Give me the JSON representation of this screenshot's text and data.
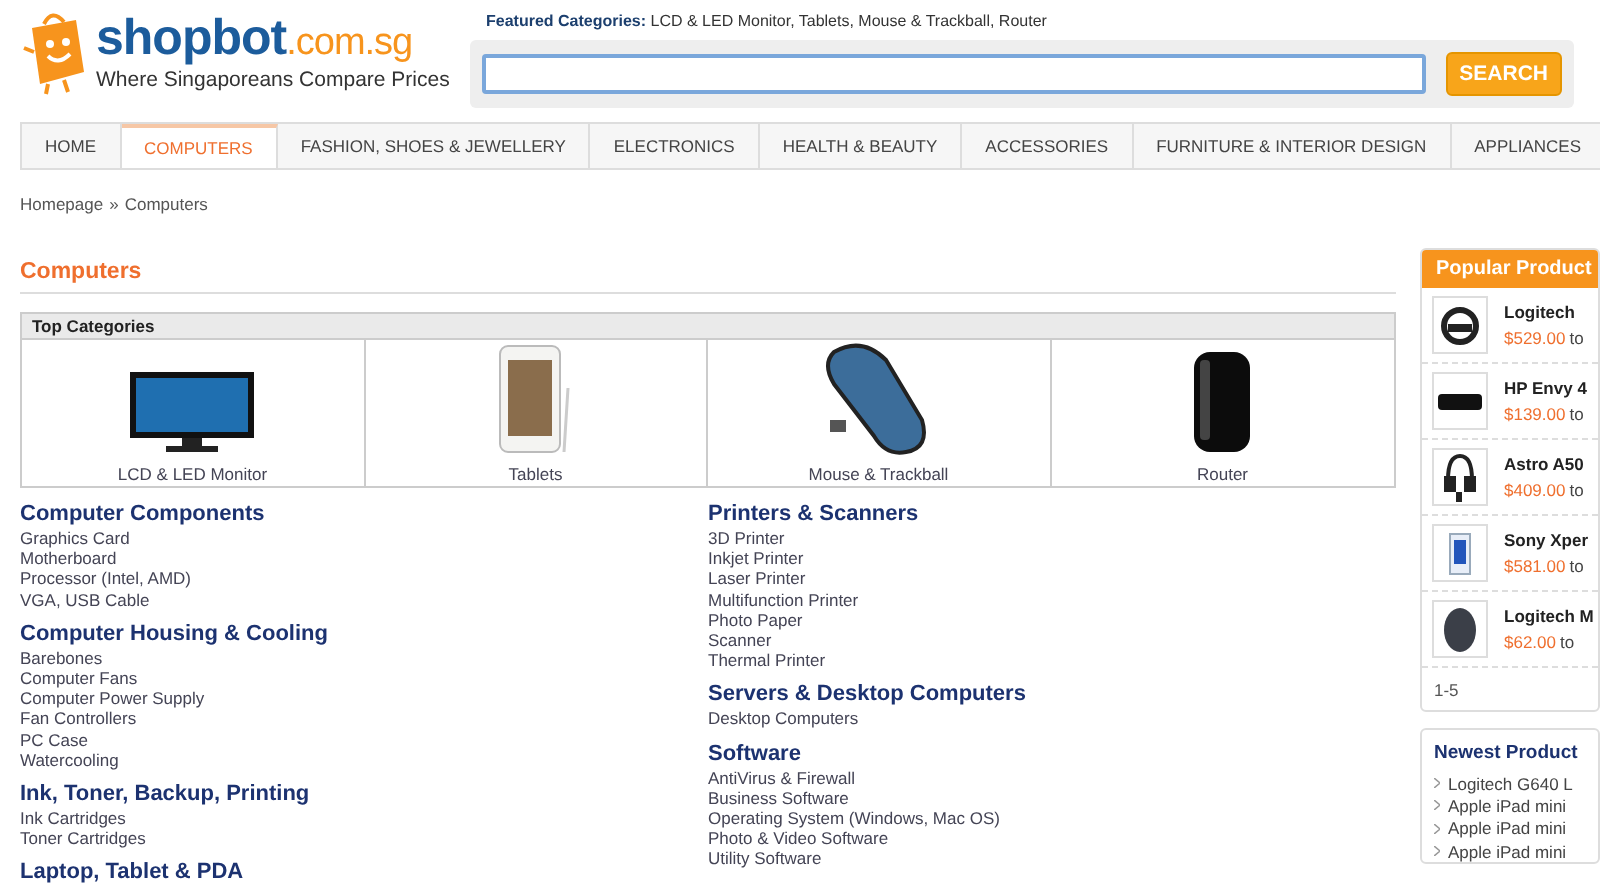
{
  "header": {
    "logo": {
      "name": "shopbot",
      "domain": ".com.sg",
      "tagline": "Where Singaporeans Compare Prices"
    },
    "featured": {
      "label": "Featured Categories:",
      "text": "LCD & LED Monitor, Tablets, Mouse & Trackball, Router"
    },
    "search": {
      "button": "SEARCH"
    }
  },
  "nav": [
    {
      "label": "HOME",
      "selected": false
    },
    {
      "label": "COMPUTERS",
      "selected": true
    },
    {
      "label": "FASHION, SHOES & JEWELLERY",
      "selected": false
    },
    {
      "label": "ELECTRONICS",
      "selected": false
    },
    {
      "label": "HEALTH & BEAUTY",
      "selected": false
    },
    {
      "label": "ACCESSORIES",
      "selected": false
    },
    {
      "label": "FURNITURE & INTERIOR DESIGN",
      "selected": false
    },
    {
      "label": "APPLIANCES",
      "selected": false
    }
  ],
  "breadcrumb": {
    "items": [
      "Homepage",
      "Computers"
    ],
    "separator": "»"
  },
  "page_title": "Computers",
  "top_categories": {
    "title": "Top Categories",
    "items": [
      {
        "label": "LCD & LED Monitor",
        "kind": "monitor"
      },
      {
        "label": "Tablets",
        "kind": "tablet"
      },
      {
        "label": "Mouse & Trackball",
        "kind": "mouse"
      },
      {
        "label": "Router",
        "kind": "router"
      }
    ]
  },
  "category_columns": [
    [
      {
        "title": "Computer Components",
        "items": [
          "Graphics Card",
          "Motherboard",
          "Processor (Intel, AMD)",
          "VGA, USB Cable"
        ]
      },
      {
        "title": "Computer Housing & Cooling",
        "items": [
          "Barebones",
          "Computer Fans",
          "Computer Power Supply",
          "Fan Controllers",
          "PC Case",
          "Watercooling"
        ]
      },
      {
        "title": "Ink, Toner, Backup, Printing",
        "items": [
          "Ink Cartridges",
          "Toner Cartridges"
        ]
      },
      {
        "title": "Laptop, Tablet & PDA"
      }
    ],
    [
      {
        "title": "Printers & Scanners",
        "items": [
          "3D Printer",
          "Inkjet Printer",
          "Laser Printer",
          "Multifunction Printer",
          "Photo Paper",
          "Scanner",
          "Thermal Printer"
        ]
      },
      {
        "title": "Servers & Desktop Computers",
        "items": [
          "Desktop Computers"
        ]
      },
      {
        "title": "Software",
        "items": [
          "AntiVirus & Firewall",
          "Business Software",
          "Operating System (Windows, Mac OS)",
          "Photo & Video Software",
          "Utility Software"
        ]
      }
    ]
  ],
  "popular": {
    "title": "Popular Product",
    "products": [
      {
        "name": "Logitech",
        "price": "$529.00",
        "to": "to",
        "kind": "wheel"
      },
      {
        "name": "HP Envy 4",
        "price": "$139.00",
        "to": "to",
        "kind": "projector"
      },
      {
        "name": "Astro A50",
        "price": "$409.00",
        "to": "to",
        "kind": "headset"
      },
      {
        "name": "Sony Xper",
        "price": "$581.00",
        "to": "to",
        "kind": "phone"
      },
      {
        "name": "Logitech M",
        "price": "$62.00",
        "to": "to",
        "kind": "mouse"
      }
    ],
    "pager": "1-5"
  },
  "newest": {
    "title": "Newest Product",
    "items": [
      "Logitech G640 L",
      "Apple iPad mini",
      "Apple iPad mini",
      "Apple iPad mini"
    ]
  }
}
